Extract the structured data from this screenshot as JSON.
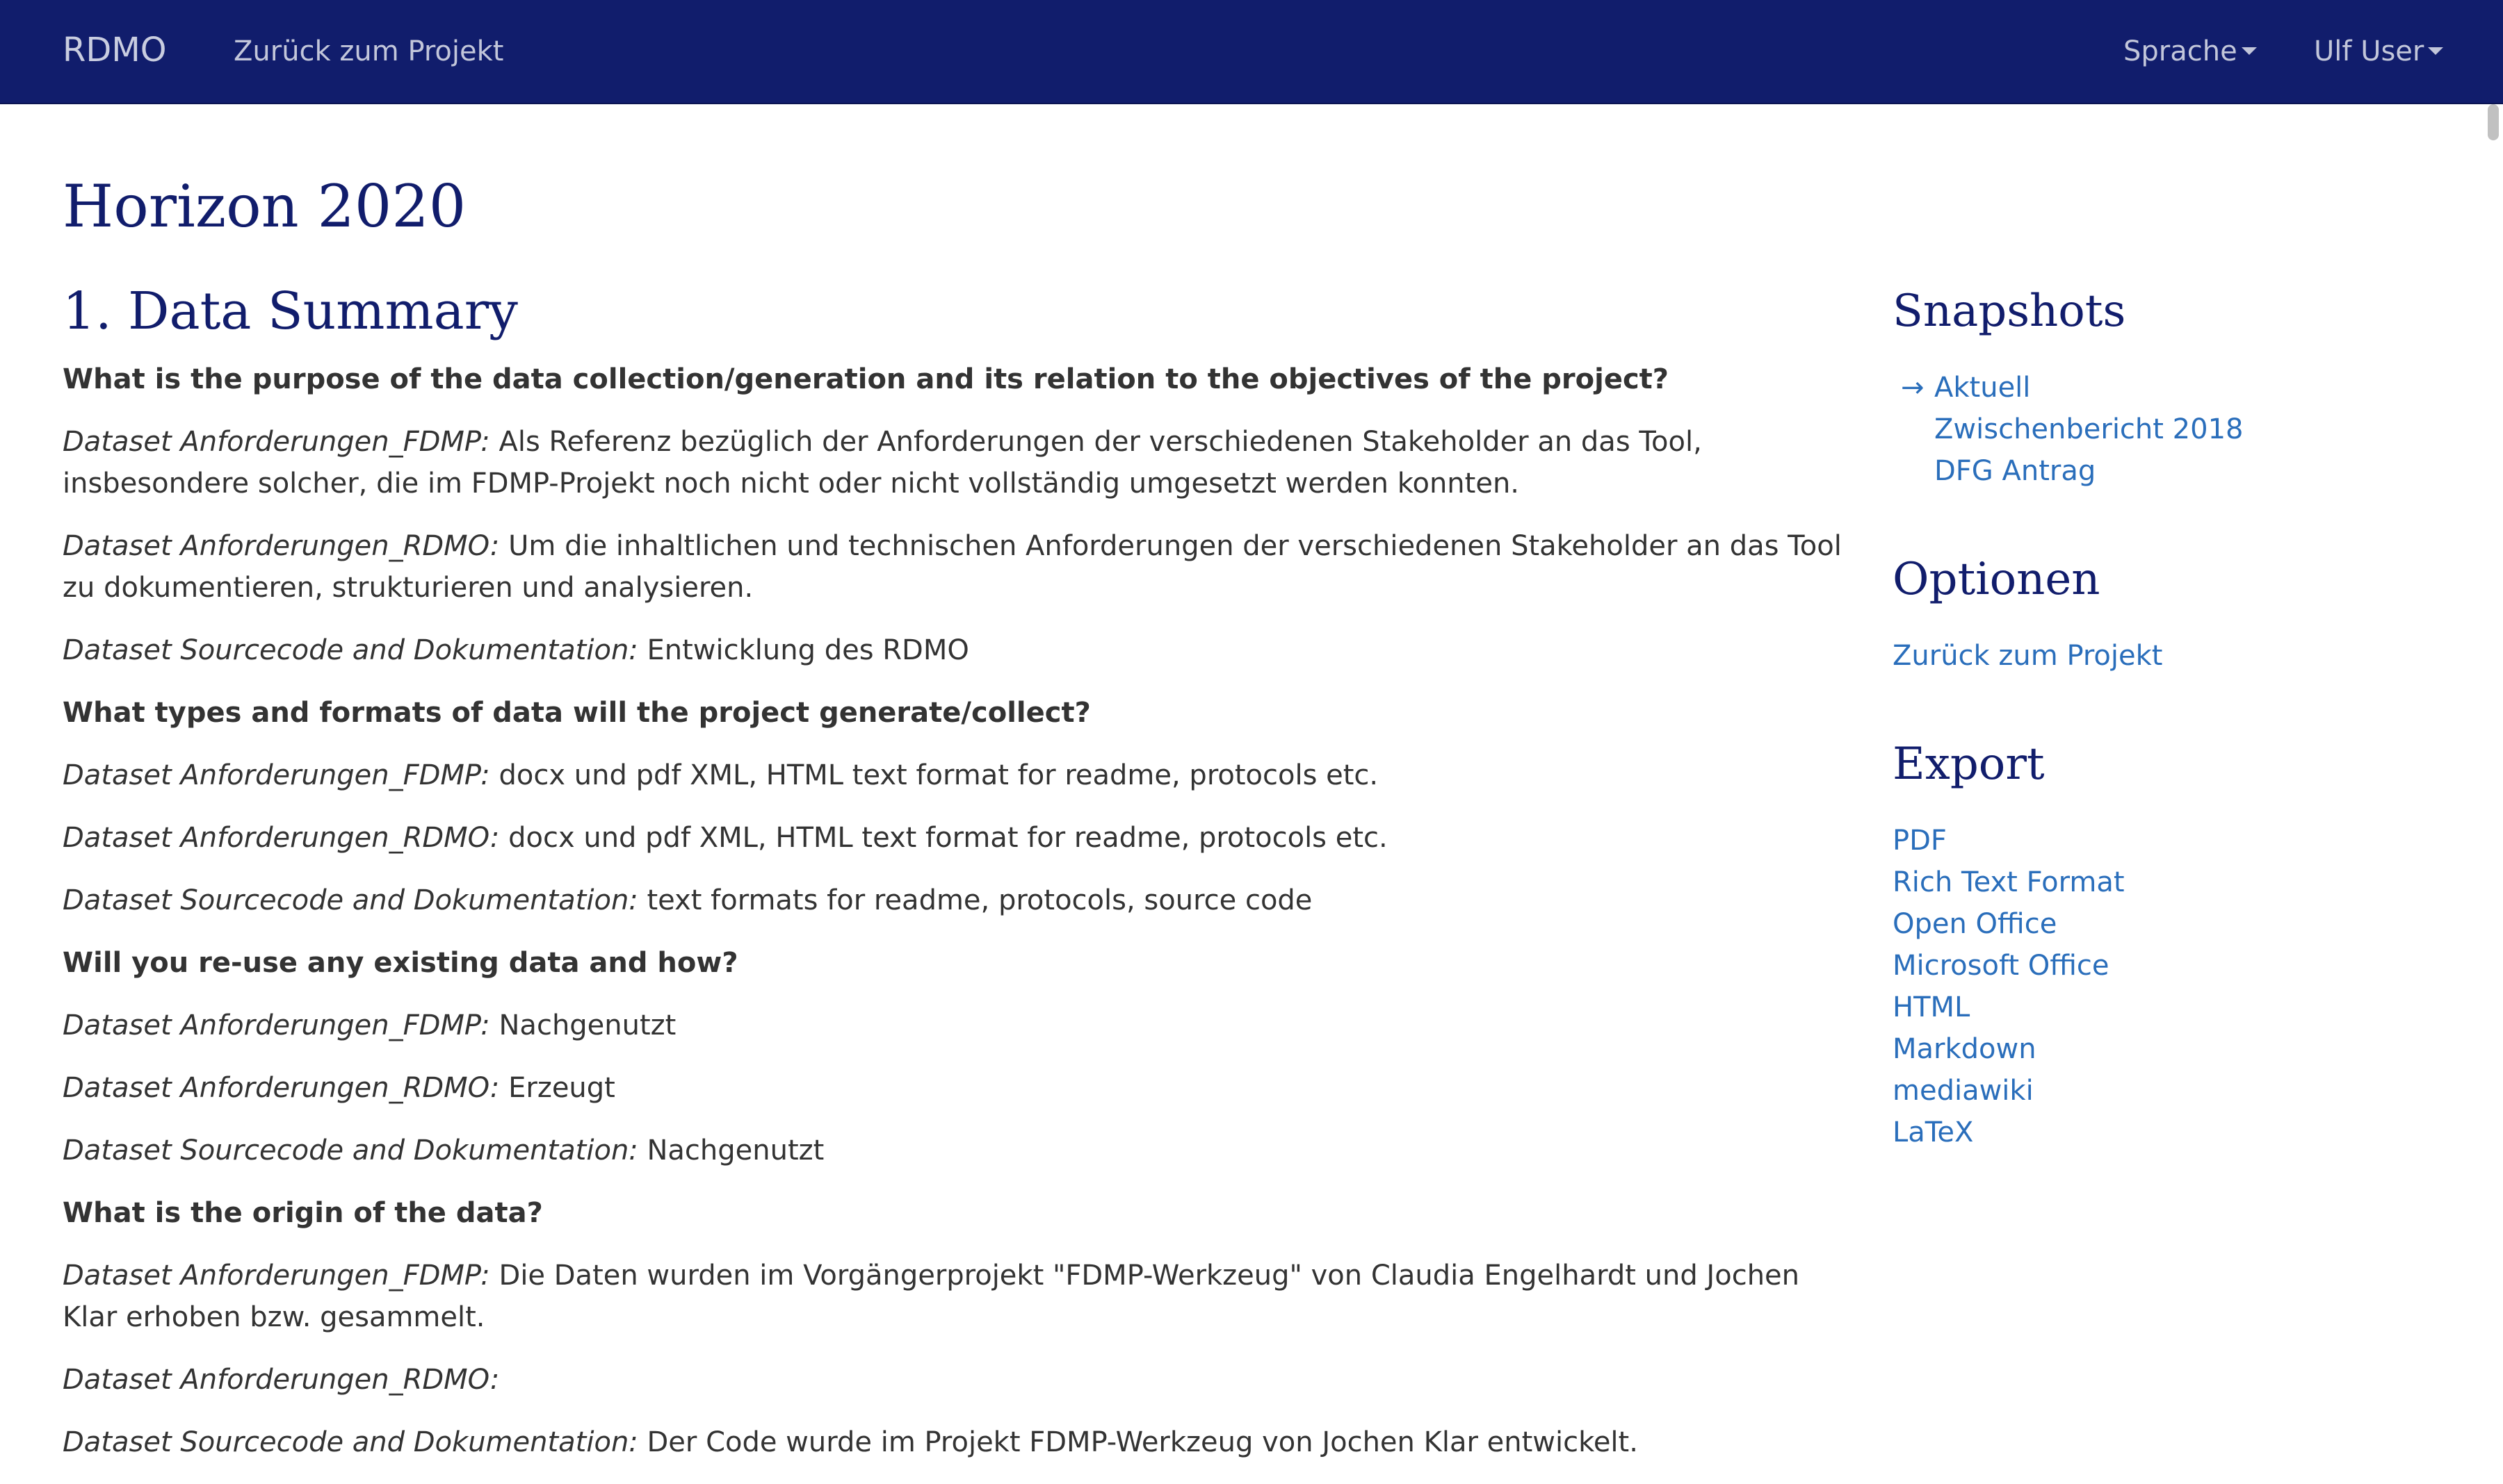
{
  "navbar": {
    "brand": "RDMO",
    "back_link": "Zurück zum Projekt",
    "language": "Sprache",
    "user": "Ulf User"
  },
  "page": {
    "title": "Horizon 2020"
  },
  "section": {
    "title": "1. Data Summary",
    "blocks": [
      {
        "type": "question",
        "text": "What is the purpose of the data collection/generation and its relation to the objectives of the project?"
      },
      {
        "type": "answer",
        "dataset": "Dataset Anforderungen_FDMP:",
        "text": " Als Referenz bezüglich der Anforderungen der verschiedenen Stakeholder an das Tool, insbesondere solcher, die im FDMP-Projekt noch nicht oder nicht vollständig umgesetzt werden konnten."
      },
      {
        "type": "answer",
        "dataset": "Dataset Anforderungen_RDMO:",
        "text": " Um die inhaltlichen und technischen Anforderungen der verschiedenen Stakeholder an das Tool zu dokumentieren, strukturieren und analysieren."
      },
      {
        "type": "answer",
        "dataset": "Dataset Sourcecode and Dokumentation:",
        "text": " Entwicklung des RDMO"
      },
      {
        "type": "question",
        "text": "What types and formats of data will the project generate/collect?"
      },
      {
        "type": "answer",
        "dataset": "Dataset Anforderungen_FDMP:",
        "text": " docx und pdf XML, HTML text format for readme, protocols etc."
      },
      {
        "type": "answer",
        "dataset": "Dataset Anforderungen_RDMO:",
        "text": " docx und pdf XML, HTML text format for readme, protocols etc."
      },
      {
        "type": "answer",
        "dataset": "Dataset Sourcecode and Dokumentation:",
        "text": " text formats for readme, protocols, source code"
      },
      {
        "type": "question",
        "text": "Will you re-use any existing data and how?"
      },
      {
        "type": "answer",
        "dataset": "Dataset Anforderungen_FDMP:",
        "text": " Nachgenutzt"
      },
      {
        "type": "answer",
        "dataset": "Dataset Anforderungen_RDMO:",
        "text": " Erzeugt"
      },
      {
        "type": "answer",
        "dataset": "Dataset Sourcecode and Dokumentation:",
        "text": " Nachgenutzt"
      },
      {
        "type": "question",
        "text": "What is the origin of the data?"
      },
      {
        "type": "answer",
        "dataset": "Dataset Anforderungen_FDMP:",
        "text": " Die Daten wurden im Vorgängerprojekt \"FDMP-Werkzeug\" von Claudia Engelhardt und Jochen Klar erhoben bzw. gesammelt."
      },
      {
        "type": "answer",
        "dataset": "Dataset Anforderungen_RDMO:",
        "text": ""
      },
      {
        "type": "answer",
        "dataset": "Dataset Sourcecode and Dokumentation:",
        "text": " Der Code wurde im Projekt FDMP-Werkzeug von Jochen Klar entwickelt."
      }
    ]
  },
  "sidebar": {
    "snapshots": {
      "title": "Snapshots",
      "current_marker": "→",
      "items": [
        "Aktuell",
        "Zwischenbericht 2018",
        "DFG Antrag"
      ]
    },
    "options": {
      "title": "Optionen",
      "items": [
        "Zurück zum Projekt"
      ]
    },
    "export": {
      "title": "Export",
      "items": [
        "PDF",
        "Rich Text Format",
        "Open Office",
        "Microsoft Office",
        "HTML",
        "Markdown",
        "mediawiki",
        "LaTeX"
      ]
    }
  }
}
